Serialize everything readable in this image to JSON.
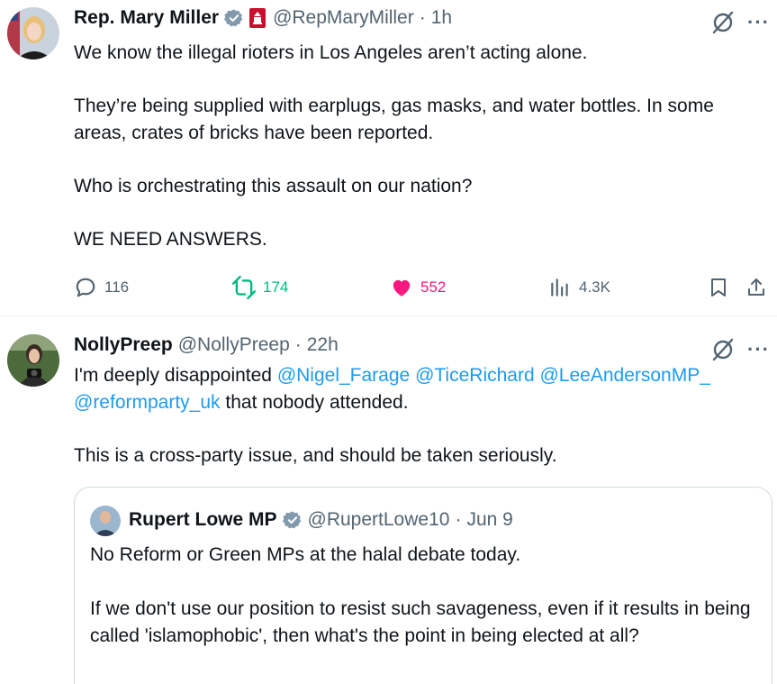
{
  "tweet1": {
    "display_name": "Rep. Mary Miller",
    "handle": "@RepMaryMiller",
    "separator": "·",
    "time": "1h",
    "paragraphs": [
      "We know the illegal rioters in Los Angeles aren’t acting alone.",
      "They’re being supplied with earplugs, gas masks, and water bottles. In some areas, crates of bricks have been reported.",
      "Who is orchestrating this assault on our nation?",
      "WE NEED ANSWERS."
    ],
    "replies": "116",
    "reposts": "174",
    "likes": "552",
    "views": "4.3K"
  },
  "tweet2": {
    "display_name": "NollyPreep",
    "handle": "@NollyPreep",
    "separator": "·",
    "time": "22h",
    "line1_prefix": "I'm deeply disappointed ",
    "mention1": "@Nigel_Farage",
    "mention2": "@TiceRichard",
    "mention3": "@LeeAndersonMP_",
    "mention4": "@reformparty_uk",
    "line2_suffix": " that nobody attended.",
    "paragraph2": "This is a cross-party issue, and should be taken seriously."
  },
  "quote": {
    "display_name": "Rupert Lowe MP",
    "handle": "@RupertLowe10",
    "separator": "·",
    "time": "Jun 9",
    "paragraphs": [
      "No Reform or Green MPs at the halal debate today.",
      "If we don't use our position to resist such savageness, even if it results in being called 'islamophobic', then what's the point in being elected at all?"
    ]
  },
  "colors": {
    "link": "#1d9bf0",
    "repost_green": "#00ba7c",
    "like_pink": "#f91880",
    "muted": "#536471",
    "verified_gray": "#829aab"
  },
  "icons": [
    "reply-icon",
    "repost-icon",
    "like-icon",
    "views-icon",
    "bookmark-icon",
    "share-icon",
    "grok-icon",
    "more-icon",
    "verified-badge-icon",
    "congress-badge-icon"
  ]
}
